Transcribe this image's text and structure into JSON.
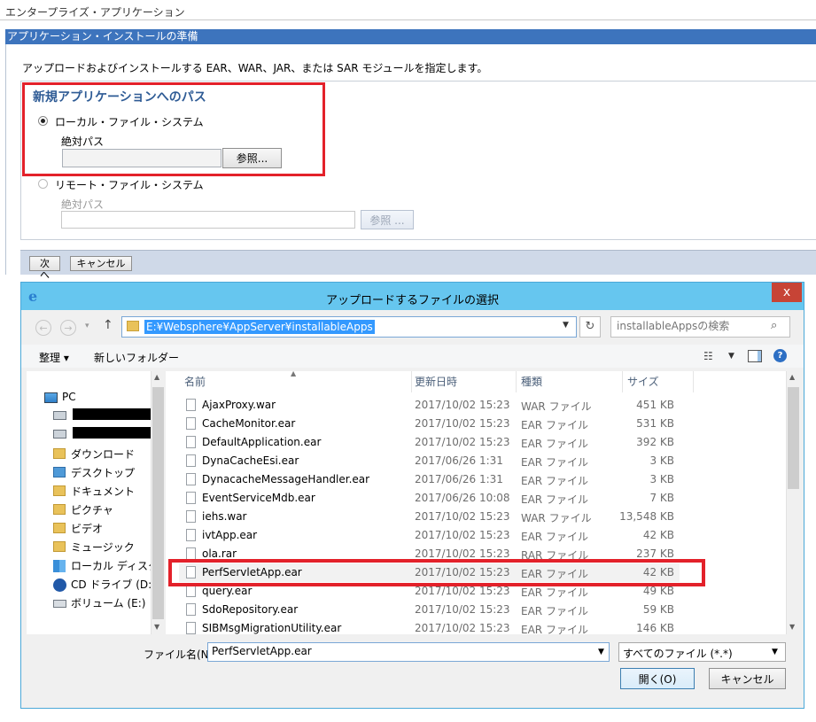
{
  "console": {
    "breadcrumb": "エンタープライズ・アプリケーション",
    "panel_title": "アプリケーション・インストールの準備",
    "instruction": "アップロードおよびインストールする EAR、WAR、JAR、または SAR モジュールを指定します。",
    "section_title": "新規アプリケーションへのパス",
    "local": {
      "label": "ローカル・ファイル・システム",
      "path_label": "絶対パス",
      "browse_label": "参照...",
      "value": "",
      "selected": true
    },
    "remote": {
      "label": "リモート・ファイル・システム",
      "path_label": "絶対パス",
      "browse_label": "参照 ...",
      "value": "",
      "selected": false
    },
    "next_label": "次へ",
    "cancel_label": "キャンセル"
  },
  "dialog": {
    "title": "アップロードするファイルの選択",
    "close_glyph": "x",
    "address": "E:¥Websphere¥AppServer¥installableApps",
    "search_placeholder": "installableAppsの検索",
    "toolbar": {
      "organize_label": "整理 ▾",
      "new_folder_label": "新しいフォルダー"
    },
    "tree": [
      {
        "label": "PC",
        "icon": "pc-icon"
      },
      {
        "label": "",
        "icon": "network-drive-icon",
        "redacted": true
      },
      {
        "label": "",
        "icon": "network-drive-icon",
        "redacted": true
      },
      {
        "label": "ダウンロード",
        "icon": "downloads-folder-icon"
      },
      {
        "label": "デスクトップ",
        "icon": "desktop-folder-icon"
      },
      {
        "label": "ドキュメント",
        "icon": "documents-folder-icon"
      },
      {
        "label": "ピクチャ",
        "icon": "pictures-folder-icon"
      },
      {
        "label": "ビデオ",
        "icon": "videos-folder-icon"
      },
      {
        "label": "ミュージック",
        "icon": "music-folder-icon"
      },
      {
        "label": "ローカル ディスク (C",
        "icon": "windows-drive-icon"
      },
      {
        "label": "CD ドライブ (D:) :",
        "icon": "cd-drive-icon"
      },
      {
        "label": "ボリューム (E:)",
        "icon": "drive-icon",
        "selected": true
      }
    ],
    "columns": {
      "name": "名前",
      "date": "更新日時",
      "type": "種類",
      "size": "サイズ"
    },
    "files": [
      {
        "name": "AjaxProxy.war",
        "date": "2017/10/02 15:23",
        "type": "WAR ファイル",
        "size": "451 KB"
      },
      {
        "name": "CacheMonitor.ear",
        "date": "2017/10/02 15:23",
        "type": "EAR ファイル",
        "size": "531 KB"
      },
      {
        "name": "DefaultApplication.ear",
        "date": "2017/10/02 15:23",
        "type": "EAR ファイル",
        "size": "392 KB"
      },
      {
        "name": "DynaCacheEsi.ear",
        "date": "2017/06/26 1:31",
        "type": "EAR ファイル",
        "size": "3 KB"
      },
      {
        "name": "DynacacheMessageHandler.ear",
        "date": "2017/06/26 1:31",
        "type": "EAR ファイル",
        "size": "3 KB"
      },
      {
        "name": "EventServiceMdb.ear",
        "date": "2017/06/26 10:08",
        "type": "EAR ファイル",
        "size": "7 KB"
      },
      {
        "name": "iehs.war",
        "date": "2017/10/02 15:23",
        "type": "WAR ファイル",
        "size": "13,548 KB"
      },
      {
        "name": "ivtApp.ear",
        "date": "2017/10/02 15:23",
        "type": "EAR ファイル",
        "size": "42 KB"
      },
      {
        "name": "ola.rar",
        "date": "2017/10/02 15:23",
        "type": "RAR ファイル",
        "size": "237 KB"
      },
      {
        "name": "PerfServletApp.ear",
        "date": "2017/10/02 15:23",
        "type": "EAR ファイル",
        "size": "42 KB",
        "selected": true
      },
      {
        "name": "query.ear",
        "date": "2017/10/02 15:23",
        "type": "EAR ファイル",
        "size": "49 KB"
      },
      {
        "name": "SdoRepository.ear",
        "date": "2017/10/02 15:23",
        "type": "EAR ファイル",
        "size": "59 KB"
      },
      {
        "name": "SIBMsgMigrationUtility.ear",
        "date": "2017/10/02 15:23",
        "type": "EAR ファイル",
        "size": "146 KB"
      }
    ],
    "filename_label": "ファイル名(N):",
    "filename_value": "PerfServletApp.ear",
    "filter_value": "すべてのファイル (*.*)",
    "open_label": "開く(O)",
    "cancel_label": "キャンセル",
    "highlight_color": "#e3212a"
  }
}
